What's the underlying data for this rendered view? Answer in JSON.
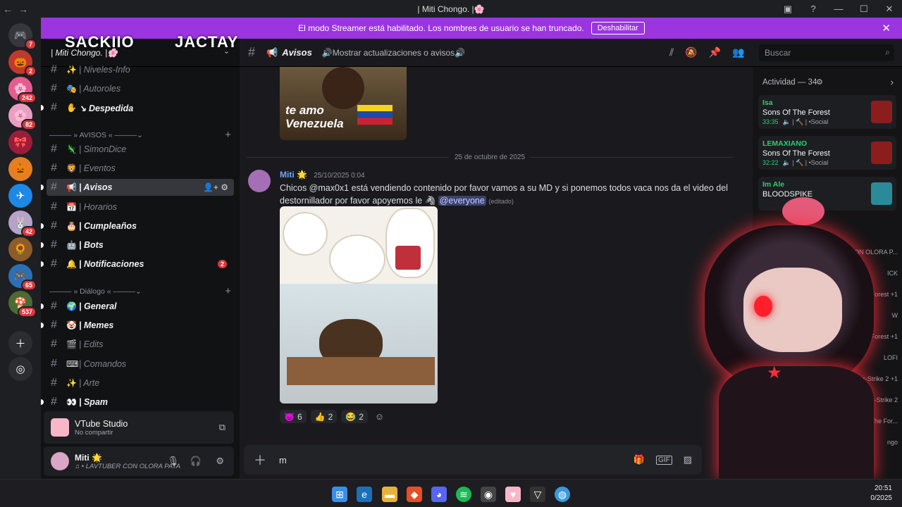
{
  "window": {
    "title": "| Miti Chongo. |🌸",
    "back": "←",
    "forward": "→"
  },
  "servers": [
    {
      "name": "discord-home",
      "glyph": "🎮",
      "badge": "7",
      "color": "#35373c"
    },
    {
      "name": "server-1",
      "glyph": "🎃",
      "badge": "2",
      "color": "#c0392b"
    },
    {
      "name": "server-2",
      "glyph": "🌸",
      "badge": "242",
      "color": "#e55c8f"
    },
    {
      "name": "server-3",
      "glyph": "🌸",
      "badge": "82",
      "color": "#e8a0c2"
    },
    {
      "name": "server-4",
      "glyph": "🎀",
      "badge": "",
      "color": "#9b1d3a"
    },
    {
      "name": "server-5",
      "glyph": "🎃",
      "badge": "",
      "color": "#e67e22"
    },
    {
      "name": "server-6",
      "glyph": "✈",
      "badge": "",
      "color": "#1e88e5"
    },
    {
      "name": "server-7",
      "glyph": "🐰",
      "badge": "42",
      "color": "#b5a3c9"
    },
    {
      "name": "server-8",
      "glyph": "🌻",
      "badge": "",
      "color": "#8e5b2b"
    },
    {
      "name": "server-9",
      "glyph": "🎮",
      "badge": "65",
      "color": "#2d6fb3"
    },
    {
      "name": "server-10",
      "glyph": "🍄",
      "badge": "537",
      "color": "#4a6b34"
    }
  ],
  "banner": {
    "text": "El modo Streamer está habilitado. Los nombres de usuario se han truncado.",
    "button": "Deshabilitar"
  },
  "guild": {
    "name": "| Miti Chongo. |🌸",
    "overlay1": "SACKIIO",
    "overlay2": "JACTAY"
  },
  "channels_top": [
    {
      "emoji": "✨",
      "label": "| Niveles-Info",
      "bold": false
    },
    {
      "emoji": "🎭",
      "label": "| Autoroles",
      "bold": false
    },
    {
      "emoji": "✋",
      "label": "↘ Despedida",
      "bold": true
    }
  ],
  "cat_avisos": "——— » AVISOS « ———",
  "channels_avisos": [
    {
      "emoji": "🦎",
      "label": "| SimonDice",
      "bold": false
    },
    {
      "emoji": "🦁",
      "label": "| Eventos",
      "bold": false
    },
    {
      "emoji": "📢",
      "label": "| Avisos",
      "bold": true
    },
    {
      "emoji": "📅",
      "label": "| Horarios",
      "bold": false
    },
    {
      "emoji": "🎂",
      "label": "| Cumpleaños",
      "bold": true
    },
    {
      "emoji": "🤖",
      "label": "| Bots",
      "bold": true
    },
    {
      "emoji": "🔔",
      "label": "| Notificaciones",
      "bold": true,
      "badge": "2"
    }
  ],
  "cat_dialogo": "——— » Diálogo « ———",
  "channels_dialogo": [
    {
      "emoji": "🌍",
      "label": "| General",
      "bold": true
    },
    {
      "emoji": "🤡",
      "label": "| Memes",
      "bold": true
    },
    {
      "emoji": "🎬",
      "label": "| Edits",
      "bold": false
    },
    {
      "emoji": "⌨",
      "label": "| Comandos",
      "bold": false
    },
    {
      "emoji": "✨",
      "label": "| Arte",
      "bold": false
    },
    {
      "emoji": "👀",
      "label": "| Spam",
      "bold": true
    }
  ],
  "voice": {
    "title": "VTube Studio",
    "status": "No compartir"
  },
  "user": {
    "name": "Miti 🌟",
    "status": "♫ • LAVTUBER CON OLORA PATAC..."
  },
  "header": {
    "channel": "Avisos",
    "topic": "🔊Mostrar actualizaciones o avisos🔊",
    "search_placeholder": "Buscar"
  },
  "messages": {
    "image_caption": "te amo Venezuela",
    "date_divider": "25 de octubre de 2025",
    "author": "Miti 🌟",
    "timestamp": "25/10/2025 0:04",
    "text": "Chicos @max0x1  está vendiendo contenido por favor vamos a su MD y si ponemos todos vaca nos da el video del destornillador por favor apoyemos le 🦓",
    "mention": "@everyone",
    "edited": "(editado)",
    "reactions": [
      {
        "emoji": "😈",
        "count": "6"
      },
      {
        "emoji": "👍",
        "count": "2"
      },
      {
        "emoji": "😂",
        "count": "2"
      }
    ]
  },
  "input": {
    "value": "m"
  },
  "activity": {
    "title": "Actividad — 34",
    "items": [
      {
        "user": "Isa",
        "game": "Sons Of The Forest",
        "time": "33:35",
        "extra": "🔈 | 🔨 | •Social"
      },
      {
        "user": "LEMAXIANO",
        "game": "Sons Of The Forest",
        "time": "32:22",
        "extra": "🔈 | 🔨 | •Social"
      },
      {
        "user": "Im Ale",
        "game": "BLOODSPIKE",
        "time": "",
        "extra": ""
      }
    ],
    "partial": [
      "UBER CON OLORA P...",
      "ICK",
      "Of The Forest +1",
      "W",
      "Of The Forest +1",
      "LOFI",
      "Counter-Strike 2 +1",
      "er-Strike 2",
      "Of The For...",
      "ngo"
    ]
  },
  "taskbar": {
    "time": "20:51",
    "date": "0/2025"
  }
}
